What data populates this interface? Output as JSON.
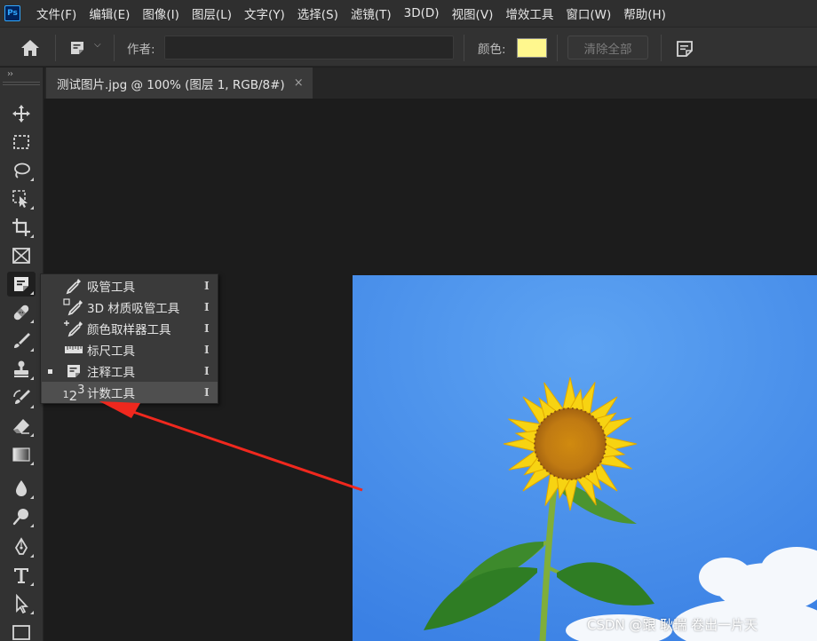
{
  "app": {
    "logo_text": "Ps"
  },
  "menubar": {
    "items": [
      "文件(F)",
      "编辑(E)",
      "图像(I)",
      "图层(L)",
      "文字(Y)",
      "选择(S)",
      "滤镜(T)",
      "3D(D)",
      "视图(V)",
      "增效工具",
      "窗口(W)",
      "帮助(H)"
    ]
  },
  "options": {
    "author_label": "作者:",
    "author_value": "",
    "color_label": "颜色:",
    "color_value": "#fff78e",
    "clear_label": "清除全部"
  },
  "document": {
    "tab_title": "测试图片.jpg @ 100% (图层 1, RGB/8#)",
    "close_glyph": "×"
  },
  "toolbar": {
    "collapse_glyph": "››",
    "tools": [
      "move-tool",
      "marquee-tool",
      "lasso-tool",
      "object-selection-tool",
      "crop-tool",
      "frame-tool",
      "note-tool",
      "healing-brush-tool",
      "brush-tool",
      "clone-stamp-tool",
      "history-brush-tool",
      "eraser-tool",
      "gradient-tool",
      "blur-tool",
      "dodge-tool",
      "pen-tool",
      "type-tool",
      "path-selection-tool",
      "rectangle-tool"
    ],
    "active_tool": "note-tool"
  },
  "flyout": {
    "items": [
      {
        "label": "吸管工具",
        "key": "I",
        "icon": "eyedropper-icon",
        "selected": false
      },
      {
        "label": "3D 材质吸管工具",
        "key": "I",
        "icon": "3d-material-eyedropper-icon",
        "selected": false
      },
      {
        "label": "颜色取样器工具",
        "key": "I",
        "icon": "color-sampler-icon",
        "selected": false
      },
      {
        "label": "标尺工具",
        "key": "I",
        "icon": "ruler-icon",
        "selected": false
      },
      {
        "label": "注释工具",
        "key": "I",
        "icon": "note-icon",
        "selected": true
      },
      {
        "label": "计数工具",
        "key": "I",
        "icon": "count-icon",
        "selected": false,
        "highlighted": true
      }
    ],
    "count_icon_glyphs": [
      "1",
      "2",
      "3"
    ]
  },
  "annotation": {
    "arrow_color": "#f0281e"
  },
  "watermark": "CSDN @跟 耿瑞 卷出一片天"
}
